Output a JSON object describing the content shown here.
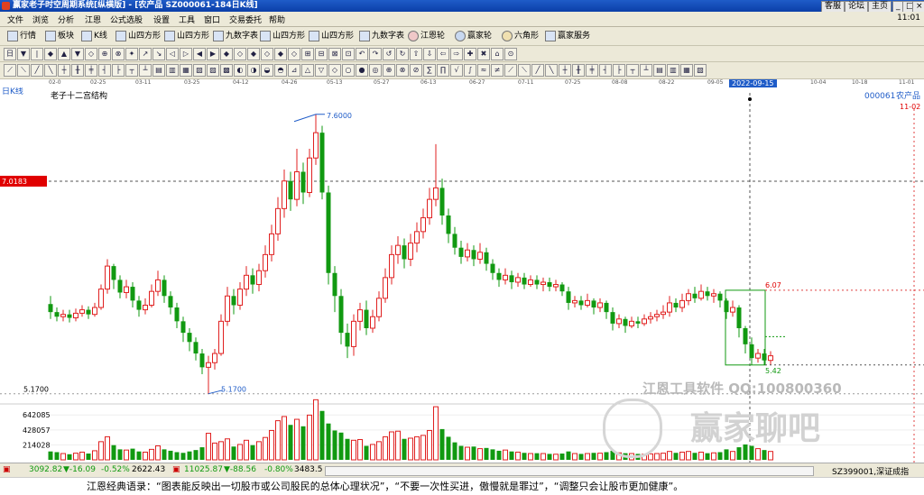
{
  "window": {
    "title": "赢家老子时空周期系统[纵横版] - [农产品  SZ000061-184日K线]",
    "buttons": [
      "客服",
      "论坛",
      "主页",
      "_",
      "□",
      "×"
    ]
  },
  "menu": {
    "items": [
      "文件",
      "浏览",
      "分析",
      "江恩",
      "公式选股",
      "设置",
      "工具",
      "窗口",
      "交易委托",
      "帮助"
    ],
    "clock": "11:01"
  },
  "toolbar1": {
    "items": [
      "行情",
      "板块",
      "K线",
      "山四方形",
      "山四方形",
      "九数字表",
      "山四方形",
      "山四方形",
      "九数字表",
      "江恩轮",
      "赢家轮",
      "六角形",
      "赢家服务"
    ]
  },
  "chart_header": {
    "period_label": "日K线",
    "study_name": "老子十二宫结构",
    "stock_code": "000061",
    "stock_name": "农产品",
    "right_tag": "11-02",
    "price_tag": "7.0183",
    "hover_date": "2022-09-15"
  },
  "date_axis": [
    "02-0",
    "02-25",
    "03-11",
    "03-25",
    "04-12",
    "04-26",
    "05-13",
    "05-27",
    "06-13",
    "06-27",
    "07-11",
    "07-25",
    "08-08",
    "08-22",
    "09-05",
    "10-04",
    "10-18",
    "11-01"
  ],
  "chart_data": {
    "type": "candlestick",
    "title": "老子十二宫结构",
    "ylim": [
      5.05,
      7.7
    ],
    "annotations": {
      "high": 7.6,
      "low": 5.17,
      "box_top": 6.07,
      "box_bottom": 5.42,
      "low_label_left": "5.1700",
      "high_label": "7.6000",
      "box_top_label": "6.07",
      "box_bottom_label": "5.42",
      "cursor_price": "7.0183"
    },
    "candles": [
      [
        5.95,
        5.88,
        6.02,
        5.82
      ],
      [
        5.88,
        5.84,
        5.92,
        5.8
      ],
      [
        5.84,
        5.86,
        5.9,
        5.8
      ],
      [
        5.86,
        5.83,
        5.9,
        5.79
      ],
      [
        5.83,
        5.87,
        5.91,
        5.8
      ],
      [
        5.87,
        5.9,
        5.94,
        5.84
      ],
      [
        5.9,
        5.86,
        5.93,
        5.82
      ],
      [
        5.86,
        5.92,
        5.96,
        5.84
      ],
      [
        5.92,
        6.08,
        6.12,
        5.9
      ],
      [
        6.08,
        6.28,
        6.34,
        6.04
      ],
      [
        6.28,
        6.16,
        6.3,
        6.08
      ],
      [
        6.16,
        6.05,
        6.2,
        6.0
      ],
      [
        6.05,
        6.1,
        6.16,
        6.0
      ],
      [
        6.1,
        5.98,
        6.14,
        5.92
      ],
      [
        5.98,
        5.9,
        6.02,
        5.84
      ],
      [
        5.9,
        5.94,
        6.0,
        5.86
      ],
      [
        5.94,
        6.06,
        6.12,
        5.92
      ],
      [
        6.06,
        6.16,
        6.24,
        6.02
      ],
      [
        6.16,
        6.02,
        6.2,
        5.96
      ],
      [
        6.02,
        5.92,
        6.06,
        5.86
      ],
      [
        5.92,
        5.8,
        5.96,
        5.74
      ],
      [
        5.8,
        5.7,
        5.84,
        5.62
      ],
      [
        5.7,
        5.62,
        5.74,
        5.54
      ],
      [
        5.62,
        5.52,
        5.66,
        5.46
      ],
      [
        5.52,
        5.4,
        5.56,
        5.34
      ],
      [
        5.4,
        5.44,
        5.5,
        5.17
      ],
      [
        5.44,
        5.52,
        5.56,
        5.38
      ],
      [
        5.52,
        5.8,
        5.86,
        5.5
      ],
      [
        5.8,
        6.02,
        6.1,
        5.76
      ],
      [
        6.02,
        5.94,
        6.08,
        5.86
      ],
      [
        5.94,
        6.08,
        6.14,
        5.9
      ],
      [
        6.08,
        6.2,
        6.28,
        6.02
      ],
      [
        6.2,
        6.12,
        6.26,
        6.04
      ],
      [
        6.12,
        6.24,
        6.3,
        6.06
      ],
      [
        6.24,
        6.38,
        6.46,
        6.18
      ],
      [
        6.38,
        6.56,
        6.64,
        6.32
      ],
      [
        6.56,
        6.78,
        6.88,
        6.5
      ],
      [
        6.78,
        7.02,
        7.12,
        6.7
      ],
      [
        7.02,
        6.86,
        7.1,
        6.76
      ],
      [
        6.86,
        7.1,
        7.3,
        6.8
      ],
      [
        7.1,
        6.92,
        7.18,
        6.82
      ],
      [
        6.92,
        7.22,
        7.3,
        6.88
      ],
      [
        7.22,
        7.44,
        7.6,
        7.16
      ],
      [
        7.44,
        6.92,
        7.5,
        6.86
      ],
      [
        6.92,
        6.22,
        6.98,
        6.12
      ],
      [
        6.22,
        6.02,
        6.28,
        5.88
      ],
      [
        6.02,
        5.7,
        6.08,
        5.6
      ],
      [
        5.7,
        5.58,
        5.78,
        5.48
      ],
      [
        5.58,
        5.8,
        5.86,
        5.5
      ],
      [
        5.8,
        5.9,
        5.96,
        5.72
      ],
      [
        5.9,
        5.74,
        5.98,
        5.68
      ],
      [
        5.74,
        5.84,
        5.9,
        5.7
      ],
      [
        5.84,
        6.0,
        6.06,
        5.8
      ],
      [
        6.0,
        6.18,
        6.26,
        5.96
      ],
      [
        6.18,
        6.38,
        6.46,
        6.12
      ],
      [
        6.38,
        6.46,
        6.54,
        6.3
      ],
      [
        6.46,
        6.34,
        6.52,
        6.26
      ],
      [
        6.34,
        6.48,
        6.56,
        6.28
      ],
      [
        6.48,
        6.58,
        6.66,
        6.4
      ],
      [
        6.58,
        6.7,
        6.78,
        6.52
      ],
      [
        6.7,
        6.86,
        6.96,
        6.64
      ],
      [
        6.86,
        6.96,
        7.34,
        6.8
      ],
      [
        6.96,
        6.72,
        7.04,
        6.64
      ],
      [
        6.72,
        6.56,
        6.78,
        6.48
      ],
      [
        6.56,
        6.44,
        6.62,
        6.38
      ],
      [
        6.44,
        6.36,
        6.5,
        6.3
      ],
      [
        6.36,
        6.42,
        6.48,
        6.32
      ],
      [
        6.42,
        6.34,
        6.46,
        6.28
      ],
      [
        6.34,
        6.4,
        6.48,
        6.3
      ],
      [
        6.4,
        6.3,
        6.44,
        6.24
      ],
      [
        6.3,
        6.22,
        6.34,
        6.16
      ],
      [
        6.22,
        6.16,
        6.26,
        6.1
      ],
      [
        6.16,
        6.2,
        6.26,
        6.12
      ],
      [
        6.2,
        6.14,
        6.24,
        6.08
      ],
      [
        6.14,
        6.18,
        6.22,
        6.1
      ],
      [
        6.18,
        6.12,
        6.22,
        6.08
      ],
      [
        6.12,
        6.16,
        6.2,
        6.1
      ],
      [
        6.16,
        6.12,
        6.2,
        6.08
      ],
      [
        6.12,
        6.14,
        6.18,
        6.06
      ],
      [
        6.14,
        6.1,
        6.18,
        6.06
      ],
      [
        6.1,
        6.12,
        6.16,
        6.06
      ],
      [
        6.12,
        6.06,
        6.14,
        6.02
      ],
      [
        6.06,
        5.96,
        6.1,
        5.9
      ],
      [
        5.96,
        5.98,
        6.02,
        5.92
      ],
      [
        5.98,
        5.94,
        6.02,
        5.9
      ],
      [
        5.94,
        5.98,
        6.04,
        5.92
      ],
      [
        5.98,
        5.92,
        6.0,
        5.86
      ],
      [
        5.92,
        5.96,
        6.0,
        5.88
      ],
      [
        5.96,
        5.88,
        5.98,
        5.82
      ],
      [
        5.88,
        5.78,
        5.92,
        5.72
      ],
      [
        5.78,
        5.82,
        5.86,
        5.74
      ],
      [
        5.82,
        5.76,
        5.84,
        5.7
      ],
      [
        5.76,
        5.8,
        5.84,
        5.74
      ],
      [
        5.8,
        5.78,
        5.84,
        5.74
      ],
      [
        5.78,
        5.82,
        5.86,
        5.76
      ],
      [
        5.82,
        5.84,
        5.88,
        5.78
      ],
      [
        5.84,
        5.86,
        5.9,
        5.8
      ],
      [
        5.86,
        5.88,
        5.94,
        5.82
      ],
      [
        5.88,
        5.96,
        6.02,
        5.84
      ],
      [
        5.96,
        5.92,
        6.0,
        5.88
      ],
      [
        5.92,
        5.98,
        6.04,
        5.88
      ],
      [
        5.98,
        6.04,
        6.08,
        5.94
      ],
      [
        6.04,
        6.0,
        6.1,
        5.96
      ],
      [
        6.0,
        6.06,
        6.12,
        5.98
      ],
      [
        6.06,
        6.02,
        6.1,
        5.98
      ],
      [
        6.02,
        6.04,
        6.08,
        5.96
      ],
      [
        6.04,
        5.98,
        6.06,
        5.92
      ],
      [
        5.98,
        5.88,
        6.0,
        5.82
      ],
      [
        5.88,
        5.92,
        5.98,
        5.84
      ],
      [
        5.92,
        5.74,
        5.94,
        5.66
      ],
      [
        5.74,
        5.6,
        5.76,
        5.52
      ],
      [
        5.6,
        5.48,
        5.66,
        5.42
      ],
      [
        5.48,
        5.52,
        5.56,
        5.44
      ],
      [
        5.52,
        5.46,
        5.56,
        5.42
      ],
      [
        5.46,
        5.5,
        5.54,
        5.42
      ]
    ],
    "volume_axis": [
      214028,
      428057,
      642085
    ],
    "volume_scale_max": 800000,
    "volumes": [
      120000,
      110000,
      90000,
      80000,
      95000,
      110000,
      90000,
      130000,
      260000,
      330000,
      210000,
      150000,
      140000,
      160000,
      120000,
      110000,
      150000,
      200000,
      150000,
      130000,
      110000,
      100000,
      120000,
      140000,
      180000,
      380000,
      240000,
      260000,
      300000,
      190000,
      220000,
      280000,
      210000,
      260000,
      320000,
      420000,
      560000,
      620000,
      500000,
      580000,
      480000,
      640000,
      860000,
      700000,
      520000,
      420000,
      390000,
      300000,
      280000,
      290000,
      200000,
      220000,
      260000,
      330000,
      400000,
      410000,
      300000,
      310000,
      330000,
      350000,
      420000,
      760000,
      440000,
      330000,
      250000,
      200000,
      180000,
      190000,
      160000,
      170000,
      150000,
      130000,
      140000,
      120000,
      110000,
      100000,
      90000,
      95000,
      90000,
      85000,
      80000,
      90000,
      120000,
      90000,
      85000,
      90000,
      100000,
      95000,
      110000,
      130000,
      100000,
      95000,
      90000,
      85000,
      80000,
      85000,
      90000,
      95000,
      120000,
      100000,
      110000,
      120000,
      100000,
      110000,
      95000,
      100000,
      110000,
      150000,
      120000,
      180000,
      220000,
      200000,
      160000,
      140000,
      120000
    ]
  },
  "watermark": {
    "contact": "江恩工具软件  QQ:100800360",
    "brand": "赢家聊吧"
  },
  "status": {
    "sh_index": "3092.82",
    "sh_change": "▼-16.09",
    "sh_pct": "-0.52%",
    "sh_amount": "2622.43",
    "sz_index": "11025.87",
    "sz_change": "▼-88.56",
    "sz_pct": "-0.80%",
    "sz_amount": "3483.5",
    "ticker": "SZ399001,深证成指"
  },
  "quote": "江恩经典语录：“图表能反映出一切股市或公司股民的总体心理状况”，“不要一次性买进，傲慢就是罪过”，“调整只会让股市更加健康”。",
  "colors": {
    "up": "#e02020",
    "down": "#119911",
    "title_blue": "#1f5cc8",
    "price_tag": "#e00000"
  }
}
